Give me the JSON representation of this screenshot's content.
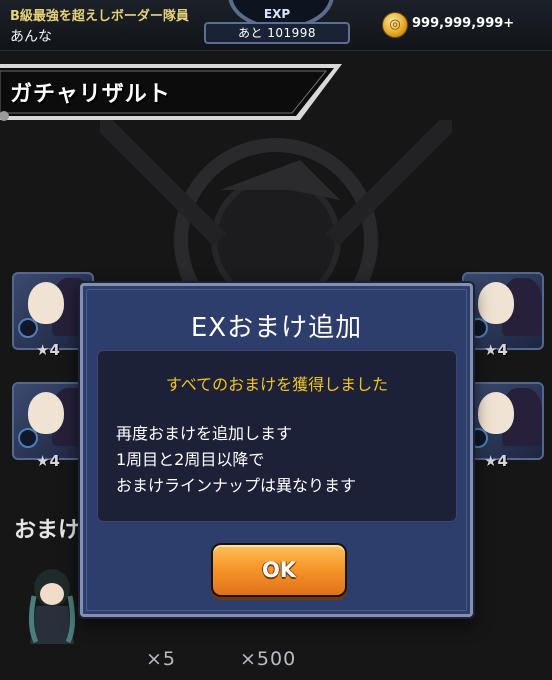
{
  "player": {
    "rank_title": "B級最強を超えしボーダー隊員",
    "name": "あんな"
  },
  "exp": {
    "label": "EXP",
    "remaining": "あと 101998"
  },
  "currency": {
    "icon": "coin-icon",
    "amount": "999,999,999+"
  },
  "screen": {
    "title": "ガチャリザルト"
  },
  "background": {
    "cards": [
      {
        "rarity": "★4"
      },
      {
        "rarity": "★4"
      },
      {
        "rarity": "★4"
      },
      {
        "rarity": "★4"
      }
    ],
    "section_label": "おまけ",
    "bonus_quantities": [
      "×5",
      "×500"
    ]
  },
  "dialog": {
    "title": "EXおまけ追加",
    "headline": "すべてのおまけを獲得しました",
    "body_lines": [
      "再度おまけを追加します",
      "1周目と2周目以降で",
      "おまけラインナップは異なります"
    ],
    "ok_label": "OK"
  },
  "colors": {
    "dialog_bg": "#2d3d6c",
    "headline": "#f2c41f",
    "ok_button": "#f7982a"
  }
}
